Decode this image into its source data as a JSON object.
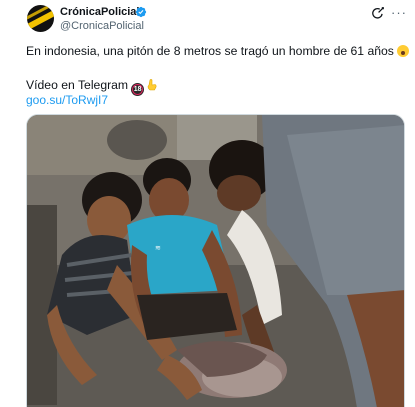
{
  "author": {
    "display_name": "CrónicaPolicial",
    "handle": "@CronicaPolicial",
    "verified": true,
    "avatar_icon": "cronica-logo-avatar"
  },
  "actions": {
    "grok_icon": "grok-icon",
    "more_icon": "more-options-icon",
    "more_glyph": "···"
  },
  "tweet": {
    "line1": "En indonesia, una pitón de 8 metros se tragó un hombre de 61 años",
    "line1_emoji": "astonished-face-emoji",
    "line2": "Vídeo en Telegram",
    "line2_emoji_18": "18",
    "line2_emoji_hand": "pointing-down-hand-emoji",
    "link": "goo.su/ToRwjI7"
  },
  "media": {
    "type": "video-thumbnail",
    "description_icon": "video-frame-image"
  },
  "colors": {
    "link": "#1d9bf0",
    "secondary_text": "#536471",
    "verified": "#1d9bf0",
    "avatar_accent": "#f2c200"
  }
}
